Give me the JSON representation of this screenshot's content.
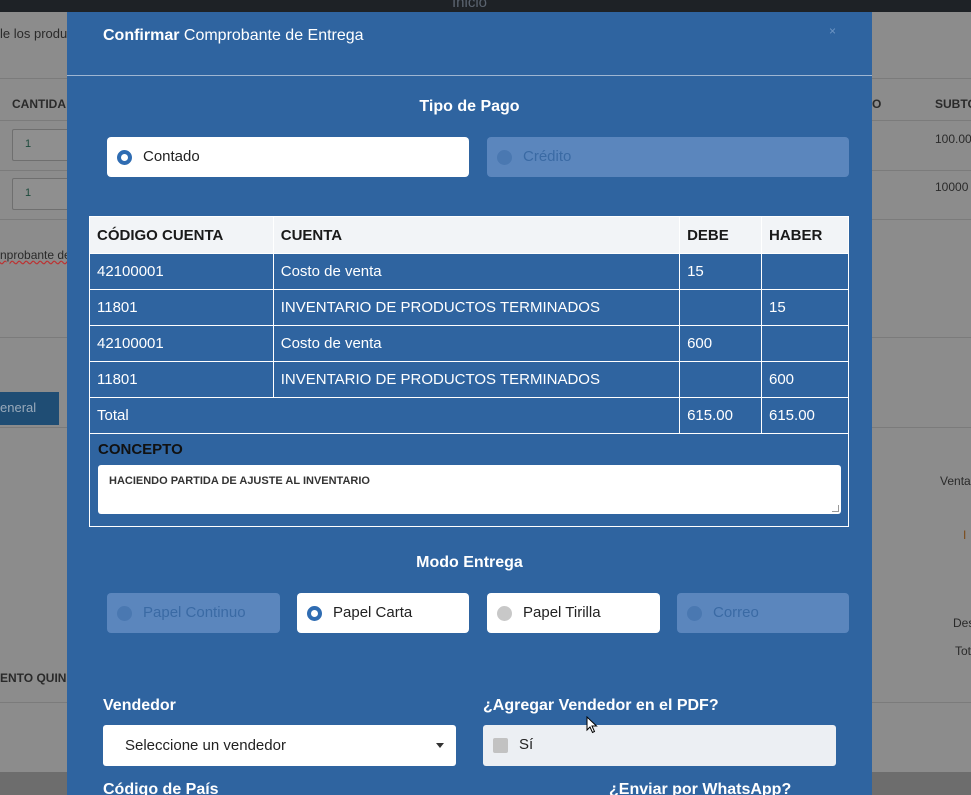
{
  "background": {
    "topbar_title": "Inicio",
    "left_clip_text": "le los produ",
    "col_cantidad": "CANTIDA",
    "col_o": "O",
    "col_subtotal": "SUBTO",
    "qty1": "1",
    "qty2": "1",
    "sub1": "100.00",
    "sub2": "10000",
    "comprobante_clip": "nprobante de",
    "general_btn": "eneral",
    "venta_clip": "Venta",
    "i_clip": "I",
    "des_clip": "Des",
    "tot_clip": "Tot",
    "ento_clip": "ENTO QUIN"
  },
  "modal": {
    "title_bold": "Confirmar",
    "title_rest": " Comprobante de Entrega",
    "close": "×",
    "tipo_pago_title": "Tipo de Pago",
    "tipo_pago": [
      {
        "label": "Contado",
        "selected": true
      },
      {
        "label": "Crédito",
        "selected": false
      }
    ],
    "table": {
      "headers": [
        "CÓDIGO CUENTA",
        "CUENTA",
        "DEBE",
        "HABER"
      ],
      "rows": [
        [
          "42100001",
          "Costo de venta",
          "15",
          ""
        ],
        [
          "11801",
          "INVENTARIO DE PRODUCTOS TERMINADOS",
          "",
          "15"
        ],
        [
          "42100001",
          "Costo de venta",
          "600",
          ""
        ],
        [
          "11801",
          "INVENTARIO DE PRODUCTOS TERMINADOS",
          "",
          "600"
        ]
      ],
      "total_label": "Total",
      "total_debe": "615.00",
      "total_haber": "615.00"
    },
    "concepto_label": "CONCEPTO",
    "concepto_value": "HACIENDO PARTIDA DE AJUSTE AL INVENTARIO",
    "modo_entrega_title": "Modo Entrega",
    "modo_entrega": [
      {
        "label": "Papel Continuo",
        "state": "disabled"
      },
      {
        "label": "Papel Carta",
        "state": "selected"
      },
      {
        "label": "Papel Tirilla",
        "state": "enabled"
      },
      {
        "label": "Correo",
        "state": "disabled"
      }
    ],
    "vendedor_label": "Vendedor",
    "vendedor_select": "Seleccione un vendedor",
    "agregar_vendedor_label": "¿Agregar Vendedor en el PDF?",
    "agregar_vendedor_option": "Sí",
    "codigo_pais_label": "Código de País",
    "whatsapp_label": "¿Enviar por WhatsApp?"
  },
  "colors": {
    "modal_bg": "#2f64a0",
    "accent": "#2f6cb2",
    "inactive_option": "#5b86bd"
  }
}
